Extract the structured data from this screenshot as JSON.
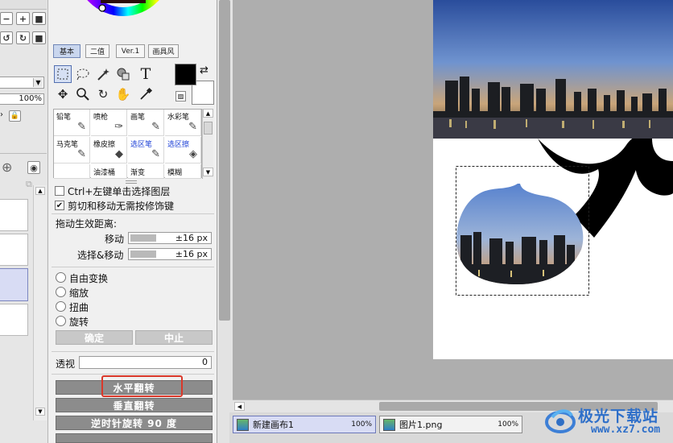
{
  "tool_tabs": [
    "基本",
    "二值",
    "Ver.1",
    "画具风"
  ],
  "tool_icons": {
    "rect_select": "rectangle-select-icon",
    "lasso": "lasso-icon",
    "magic_wand": "magic-wand-icon",
    "color_select": "color-select-icon",
    "text": "T",
    "move": "✥",
    "zoom": "⚲",
    "rotate": "↻",
    "hand": "✋",
    "eyedropper": "eyedropper-icon"
  },
  "brushes": [
    {
      "label": "铅笔",
      "blue": false
    },
    {
      "label": "喷枪",
      "blue": false
    },
    {
      "label": "画笔",
      "blue": false
    },
    {
      "label": "水彩笔",
      "blue": false
    },
    {
      "label": "马克笔",
      "blue": false
    },
    {
      "label": "橡皮擦",
      "blue": false
    },
    {
      "label": "选区笔",
      "blue": true
    },
    {
      "label": "选区擦",
      "blue": true
    },
    {
      "label": "",
      "blue": false
    },
    {
      "label": "油漆桶",
      "blue": false
    },
    {
      "label": "渐变",
      "blue": false
    },
    {
      "label": "模糊",
      "blue": false
    }
  ],
  "options": {
    "ctrl_select": "Ctrl+左键单击选择图层",
    "ctrl_select_checked": false,
    "cut_move": "剪切和移动无需按修饰键",
    "cut_move_checked": true,
    "drag_distance_title": "拖动生效距离:",
    "move_label": "移动",
    "move_value": "±16 px",
    "select_move_label": "选择&移动",
    "select_move_value": "±16 px"
  },
  "transform": {
    "options": [
      "自由变换",
      "缩放",
      "扭曲",
      "旋转"
    ],
    "ok": "确定",
    "cancel": "中止",
    "perspective_label": "透视",
    "perspective_value": "0"
  },
  "flip_buttons": {
    "horizontal": "水平翻转",
    "vertical": "垂直翻转",
    "rotate_ccw": "逆时针旋转 90 度"
  },
  "layer_panel": {
    "zoom_value": "100%"
  },
  "doc_tabs": [
    {
      "name": "新建画布1",
      "zoom": "100%",
      "selected": true
    },
    {
      "name": "图片1.png",
      "zoom": "100%",
      "selected": false
    }
  ],
  "watermark": {
    "title": "极光下载站",
    "url": "www.xz7.com"
  },
  "colors": {
    "highlight_box": "#d9382a",
    "selection_blue": "#5470b0"
  }
}
